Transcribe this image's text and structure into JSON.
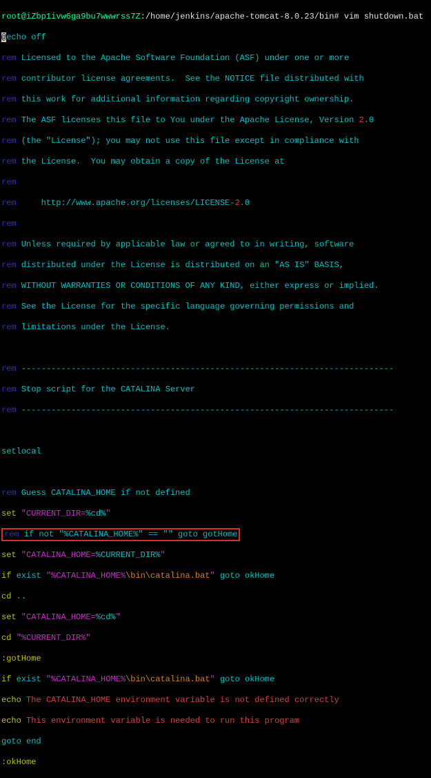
{
  "prompt": {
    "user_host": "root@iZbp1ivw6ga9bu7wwwrss7Z",
    "path": ":/home/jenkins/apache-tomcat-8.0.23/bin# ",
    "command": "vim shutdown.bat"
  },
  "file": {
    "l01_cursor": "@",
    "l01_echo": "echo",
    "l01_off": " off",
    "l02_rem": "rem",
    "l02_txt": " Licensed to the Apache Software Foundation (ASF) under one or more",
    "l03_rem": "rem",
    "l03_txt": " contributor license agreements.  See the NOTICE file distributed with",
    "l04_rem": "rem",
    "l04_txt": " this work for additional information regarding copyright ownership.",
    "l05_rem": "rem",
    "l05_txt_a": " The ASF licenses this file to You under the Apache License, Version ",
    "l05_num": "2",
    "l05_txt_b": ".0",
    "l06_rem": "rem",
    "l06_txt": " (the \"License\"); you may not use this file except in compliance with",
    "l07_rem": "rem",
    "l07_txt": " the License.  You may obtain a copy of the License at",
    "l08_rem": "rem",
    "l09_rem": "rem",
    "l09_txt_a": "     http://www.apache.org/licenses/LICENSE-",
    "l09_num": "2",
    "l09_txt_b": ".0",
    "l10_rem": "rem",
    "l11_rem": "rem",
    "l11_txt": " Unless required by applicable law or agreed to in writing, software",
    "l12_rem": "rem",
    "l12_txt": " distributed under the License is distributed on an \"AS IS\" BASIS,",
    "l13_rem": "rem",
    "l13_txt": " WITHOUT WARRANTIES OR CONDITIONS OF ANY KIND, either express or implied.",
    "l14_rem": "rem",
    "l14_txt": " See the License for the specific language governing permissions and",
    "l15_rem": "rem",
    "l15_txt": " limitations under the License.",
    "l16_rem": "rem",
    "l16_dash": " ---------------------------------------------------------------------------",
    "l17_rem": "rem",
    "l17_txt": " Stop script for the CATALINA Server",
    "l18_rem": "rem",
    "l18_dash": " ---------------------------------------------------------------------------",
    "l19_setlocal": "setlocal",
    "l20_rem": "rem",
    "l20_txt": " Guess CATALINA_HOME if not defined",
    "l21_set": "set",
    "l21_str": " \"CURRENT_DIR=",
    "l21_var": "%cd%",
    "l21_q": "\"",
    "hl_rem": "rem",
    "hl_txt_a": " if not ",
    "hl_str": "\"%CATALINA_HOME%\"",
    "hl_txt_b": " == \"\" goto gotHome",
    "l23_set": "set",
    "l23_str": " \"CATALINA_HOME=",
    "l23_var": "%CURRENT_DIR%",
    "l23_q": "\"",
    "l24_if": "if",
    "l24_ex": " exist ",
    "l24_str_a": "\"%CATALINA_HOME%",
    "l24_file": "\\bin\\catalina.bat",
    "l24_q": "\"",
    "l24_goto": " goto okHome",
    "l25_cd": "cd",
    "l25_dots": " ..",
    "l26_set": "set",
    "l26_str": " \"CATALINA_HOME=",
    "l26_var": "%cd%",
    "l26_q": "\"",
    "l27_cd": "cd",
    "l27_str": " \"%CURRENT_DIR%\"",
    "l28_label": ":gotHome",
    "l29_if": "if",
    "l29_ex": " exist ",
    "l29_str_a": "\"%CATALINA_HOME%",
    "l29_file": "\\bin\\catalina.bat",
    "l29_q": "\"",
    "l29_goto": " goto okHome",
    "l30_echo": "echo",
    "l30_txt": " The CATALINA_HOME environment variable is not defined correctly",
    "l31_echo": "echo",
    "l31_txt": " This environment variable is needed to run this program",
    "l32_goto": "goto end",
    "l33_label": ":okHome"
  }
}
